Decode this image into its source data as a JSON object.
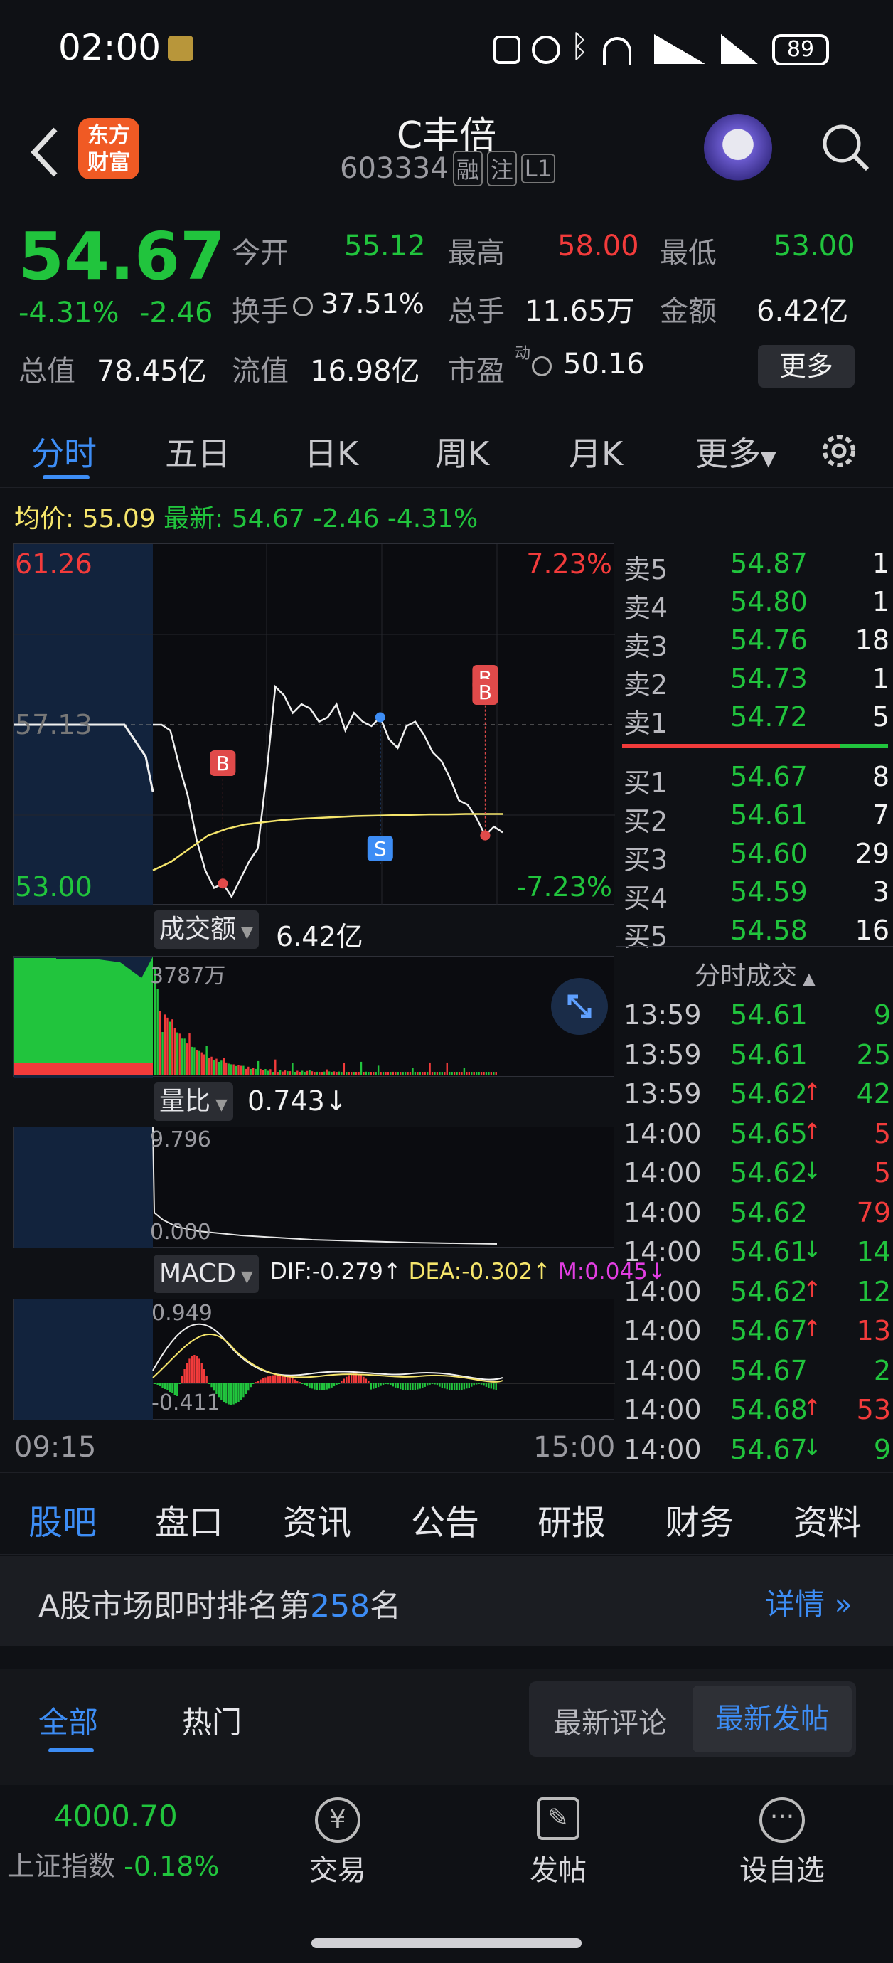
{
  "status_bar": {
    "time": "02:00",
    "battery": "89"
  },
  "header": {
    "logo_line1": "东方",
    "logo_line2": "财富",
    "stock_name": "C丰倍",
    "stock_code": "603334",
    "tags": [
      "融",
      "注",
      "L1"
    ]
  },
  "quote": {
    "price": "54.67",
    "change_pct": "-4.31%",
    "change": "-2.46",
    "open_label": "今开",
    "open": "55.12",
    "high_label": "最高",
    "high": "58.00",
    "low_label": "最低",
    "low": "53.00",
    "turnover_label": "换手",
    "turnover": "37.51%",
    "volume_label": "总手",
    "volume": "11.65万",
    "amount_label": "金额",
    "amount": "6.42亿",
    "mktcap_label": "总值",
    "mktcap": "78.45亿",
    "float_label": "流值",
    "float": "16.98亿",
    "pe_label": "市盈",
    "pe_sup": "动",
    "pe": "50.16",
    "more_button": "更多"
  },
  "tabs": [
    "分时",
    "五日",
    "日K",
    "周K",
    "月K",
    "更多"
  ],
  "summary": {
    "avg_label": "均价:",
    "avg": "55.09",
    "latest_label": "最新:",
    "latest": "54.67",
    "chg": "-2.46",
    "pct": "-4.31%"
  },
  "chart_data": {
    "type": "line",
    "y_top": "61.26",
    "y_bottom": "53.00",
    "pct_top": "7.23%",
    "pct_bottom": "-7.23%",
    "ref_price": "57.13",
    "price_series": [
      57.13,
      57.13,
      57.0,
      56.2,
      55.5,
      54.5,
      53.8,
      53.4,
      53.5,
      53.2,
      53.6,
      54.0,
      54.3,
      56.0,
      58.0,
      57.8,
      57.4,
      57.6,
      57.5,
      57.2,
      57.3,
      57.6,
      57.0,
      57.4,
      57.2,
      57.1,
      57.3,
      56.8,
      56.6,
      57.1,
      57.2,
      56.9,
      56.5,
      56.3,
      55.9,
      55.4,
      55.3,
      55.0,
      54.6,
      54.8,
      54.67
    ],
    "avg_series": [
      53.8,
      54.0,
      54.3,
      54.6,
      54.75,
      54.85,
      54.9,
      54.95,
      54.98,
      55.0,
      55.02,
      55.04,
      55.05,
      55.06,
      55.07,
      55.08,
      55.08,
      55.09,
      55.09,
      55.09
    ],
    "x_start": "09:15",
    "x_end": "15:00",
    "markers": [
      {
        "label": "B"
      },
      {
        "label": "S"
      },
      {
        "label": "B"
      },
      {
        "label": "B"
      }
    ],
    "volume_label": "成交额",
    "volume_total": "6.42亿",
    "volume_max": "3787万",
    "ratio_label": "量比",
    "ratio_value": "0.743",
    "ratio_max": "9.796",
    "ratio_min": "0.000",
    "macd_label": "MACD",
    "dif": "DIF:-0.279",
    "dea": "DEA:-0.302",
    "m": "M:0.045",
    "macd_max": "0.949",
    "macd_min": "-0.411"
  },
  "order_book": {
    "asks": [
      {
        "l": "卖5",
        "p": "54.87",
        "v": "1"
      },
      {
        "l": "卖4",
        "p": "54.80",
        "v": "1"
      },
      {
        "l": "卖3",
        "p": "54.76",
        "v": "18"
      },
      {
        "l": "卖2",
        "p": "54.73",
        "v": "1"
      },
      {
        "l": "卖1",
        "p": "54.72",
        "v": "5"
      }
    ],
    "bids": [
      {
        "l": "买1",
        "p": "54.67",
        "v": "8"
      },
      {
        "l": "买2",
        "p": "54.61",
        "v": "7"
      },
      {
        "l": "买3",
        "p": "54.60",
        "v": "29"
      },
      {
        "l": "买4",
        "p": "54.59",
        "v": "3"
      },
      {
        "l": "买5",
        "p": "54.58",
        "v": "16"
      }
    ]
  },
  "ticks_title": "分时成交",
  "ticks": [
    {
      "t": "13:59",
      "p": "54.61",
      "a": "",
      "v": "9",
      "vc": "g"
    },
    {
      "t": "13:59",
      "p": "54.61",
      "a": "",
      "v": "25",
      "vc": "g"
    },
    {
      "t": "13:59",
      "p": "54.62",
      "a": "↑",
      "v": "42",
      "vc": "g"
    },
    {
      "t": "14:00",
      "p": "54.65",
      "a": "↑",
      "v": "5",
      "vc": "r"
    },
    {
      "t": "14:00",
      "p": "54.62",
      "a": "↓",
      "v": "5",
      "vc": "r"
    },
    {
      "t": "14:00",
      "p": "54.62",
      "a": "",
      "v": "79",
      "vc": "r"
    },
    {
      "t": "14:00",
      "p": "54.61",
      "a": "↓",
      "v": "14",
      "vc": "g"
    },
    {
      "t": "14:00",
      "p": "54.62",
      "a": "↑",
      "v": "12",
      "vc": "g"
    },
    {
      "t": "14:00",
      "p": "54.67",
      "a": "↑",
      "v": "13",
      "vc": "r"
    },
    {
      "t": "14:00",
      "p": "54.67",
      "a": "",
      "v": "2",
      "vc": "g"
    },
    {
      "t": "14:00",
      "p": "54.68",
      "a": "↑",
      "v": "53",
      "vc": "r"
    },
    {
      "t": "14:00",
      "p": "54.67",
      "a": "↓",
      "v": "9",
      "vc": "g"
    }
  ],
  "bottom_tabs": [
    "股吧",
    "盘口",
    "资讯",
    "公告",
    "研报",
    "财务",
    "资料"
  ],
  "rank": {
    "prefix": "A股市场即时排名第",
    "num": "258",
    "suffix": "名",
    "detail": "详情"
  },
  "forum_tabs": {
    "all": "全部",
    "hot": "热门",
    "latest_comment": "最新评论",
    "latest_post": "最新发帖"
  },
  "footer": {
    "index_value": "4000.70",
    "index_name": "上证指数",
    "index_chg": "-0.18%",
    "trade": "交易",
    "post": "发帖",
    "watch": "设自选"
  },
  "colors": {
    "up": "#f23b3b",
    "down": "#21c43d",
    "accent": "#3d8df5",
    "avg_line": "#f5e56b"
  }
}
